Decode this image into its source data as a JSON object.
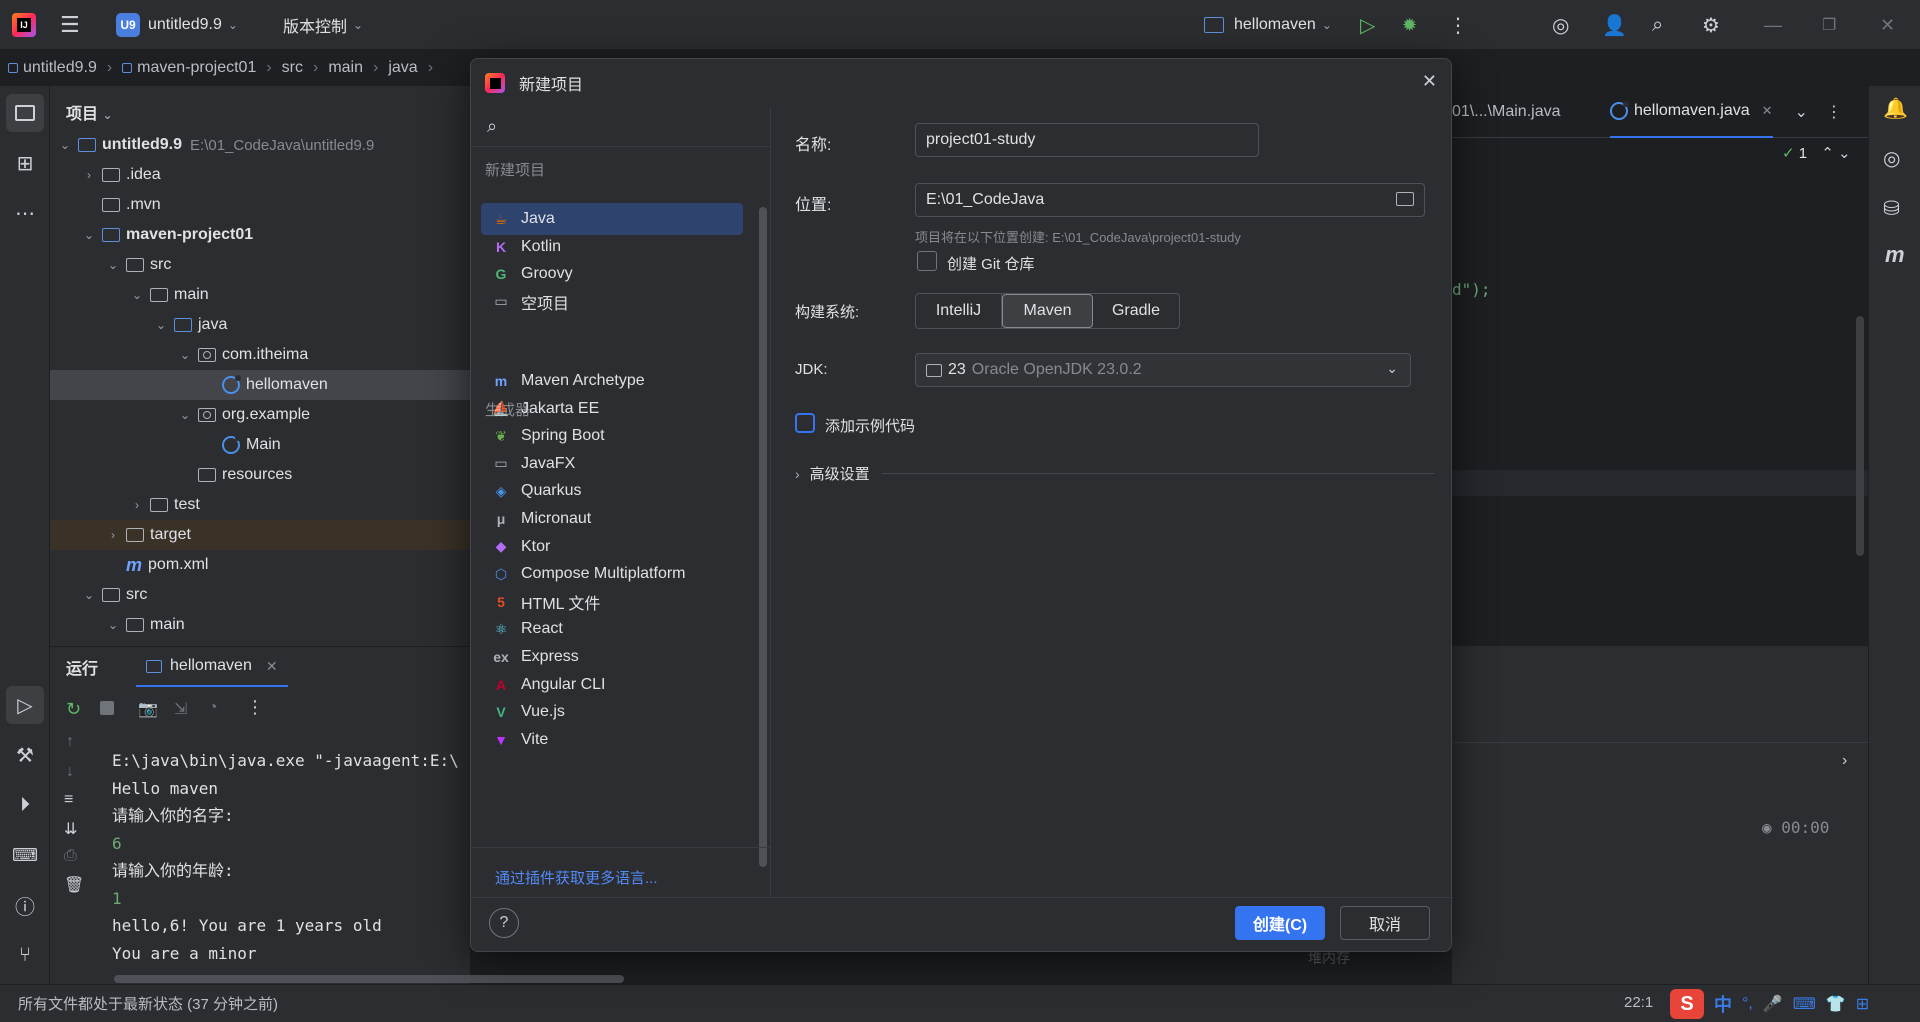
{
  "titlebar": {
    "project_badge": "U9",
    "project_name": "untitled9.9",
    "vcs_label": "版本控制",
    "run_config": "hellomaven"
  },
  "breadcrumb": [
    "untitled9.9",
    "maven-project01",
    "src",
    "main",
    "java"
  ],
  "project_panel": {
    "title": "项目",
    "tree": [
      {
        "label": "untitled9.9",
        "path": "E:\\01_CodeJava\\untitled9.9",
        "indent": 0,
        "arrow": "down",
        "icon": "module"
      },
      {
        "label": ".idea",
        "indent": 1,
        "arrow": "right",
        "icon": "folder"
      },
      {
        "label": ".mvn",
        "indent": 1,
        "arrow": "",
        "icon": "folder"
      },
      {
        "label": "maven-project01",
        "indent": 1,
        "arrow": "down",
        "icon": "module"
      },
      {
        "label": "src",
        "indent": 2,
        "arrow": "down",
        "icon": "folder"
      },
      {
        "label": "main",
        "indent": 3,
        "arrow": "down",
        "icon": "folder"
      },
      {
        "label": "java",
        "indent": 4,
        "arrow": "down",
        "icon": "folder-blue"
      },
      {
        "label": "com.itheima",
        "indent": 5,
        "arrow": "down",
        "icon": "package"
      },
      {
        "label": "hellomaven",
        "indent": 6,
        "arrow": "",
        "icon": "java-class"
      },
      {
        "label": "org.example",
        "indent": 5,
        "arrow": "down",
        "icon": "package"
      },
      {
        "label": "Main",
        "indent": 6,
        "arrow": "",
        "icon": "java-class"
      },
      {
        "label": "resources",
        "indent": 5,
        "arrow": "",
        "icon": "folder"
      },
      {
        "label": "test",
        "indent": 3,
        "arrow": "right",
        "icon": "folder"
      },
      {
        "label": "target",
        "indent": 2,
        "arrow": "right",
        "icon": "folder"
      },
      {
        "label": "pom.xml",
        "indent": 2,
        "arrow": "",
        "icon": "maven"
      },
      {
        "label": "src",
        "indent": 1,
        "arrow": "down",
        "icon": "folder"
      },
      {
        "label": "main",
        "indent": 2,
        "arrow": "down",
        "icon": "folder"
      }
    ]
  },
  "run_panel": {
    "title": "运行",
    "tab": "hellomaven",
    "console": [
      {
        "text": "E:\\java\\bin\\java.exe \"-javaagent:E:\\",
        "green": false
      },
      {
        "text": "Hello maven",
        "green": false
      },
      {
        "text": "请输入你的名字:",
        "green": false
      },
      {
        "text": "6",
        "green": true
      },
      {
        "text": "请输入你的年龄:",
        "green": false
      },
      {
        "text": "1",
        "green": true
      },
      {
        "text": "hello,6! You are 1 years old",
        "green": false
      },
      {
        "text": "You are a minor",
        "green": false
      }
    ]
  },
  "editor": {
    "tab1": "01\\...\\Main.java",
    "tab2": "hellomaven.java",
    "code_fragment": "d\");",
    "inspection_count": "1",
    "timer": "00:00",
    "memory_label": "堆内存"
  },
  "statusbar": {
    "message": "所有文件都处于最新状态 (37 分钟之前)",
    "position": "22:1",
    "ime": [
      "中",
      "°,"
    ]
  },
  "dialog": {
    "title": "新建项目",
    "group_new": "新建项目",
    "new_items": [
      {
        "label": "Java",
        "icon": "java-icon",
        "color": "#e76f00",
        "glyph": "☕"
      },
      {
        "label": "Kotlin",
        "icon": "kotlin-icon",
        "color": "#b36cf6",
        "glyph": "K"
      },
      {
        "label": "Groovy",
        "icon": "groovy-icon",
        "color": "#4fb877",
        "glyph": "G"
      },
      {
        "label": "空项目",
        "icon": "empty-project-icon",
        "color": "#aeb1b8",
        "glyph": "▭"
      }
    ],
    "group_gen": "生成器",
    "gen_items": [
      {
        "label": "Maven Archetype",
        "icon": "maven-icon",
        "color": "#6fa3ff",
        "glyph": "m"
      },
      {
        "label": "Jakarta EE",
        "icon": "jakarta-icon",
        "color": "#f0a030",
        "glyph": "⛵"
      },
      {
        "label": "Spring Boot",
        "icon": "spring-icon",
        "color": "#6ab04c",
        "glyph": "❦"
      },
      {
        "label": "JavaFX",
        "icon": "javafx-icon",
        "color": "#aeb1b8",
        "glyph": "▭"
      },
      {
        "label": "Quarkus",
        "icon": "quarkus-icon",
        "color": "#4695eb",
        "glyph": "◈"
      },
      {
        "label": "Micronaut",
        "icon": "micronaut-icon",
        "color": "#aeb1b8",
        "glyph": "μ"
      },
      {
        "label": "Ktor",
        "icon": "ktor-icon",
        "color": "#b36cf6",
        "glyph": "◆"
      },
      {
        "label": "Compose Multiplatform",
        "icon": "compose-icon",
        "color": "#4a8fe8",
        "glyph": "⬡"
      },
      {
        "label": "HTML 文件",
        "icon": "html-icon",
        "color": "#e44d26",
        "glyph": "5"
      },
      {
        "label": "React",
        "icon": "react-icon",
        "color": "#61dafb",
        "glyph": "⚛"
      },
      {
        "label": "Express",
        "icon": "express-icon",
        "color": "#aeb1b8",
        "glyph": "ex"
      },
      {
        "label": "Angular CLI",
        "icon": "angular-icon",
        "color": "#c3002f",
        "glyph": "A"
      },
      {
        "label": "Vue.js",
        "icon": "vue-icon",
        "color": "#41b883",
        "glyph": "V"
      },
      {
        "label": "Vite",
        "icon": "vite-icon",
        "color": "#bd34fe",
        "glyph": "▼"
      }
    ],
    "more_link": "通过插件获取更多语言...",
    "name_label": "名称:",
    "name_value": "project01-study",
    "location_label": "位置:",
    "location_value": "E:\\01_CodeJava",
    "location_hint": "项目将在以下位置创建: E:\\01_CodeJava\\project01-study",
    "git_label": "创建 Git 仓库",
    "build_label": "构建系统:",
    "build_options": [
      "IntelliJ",
      "Maven",
      "Gradle"
    ],
    "build_selected": "Maven",
    "jdk_label": "JDK:",
    "jdk_version": "23",
    "jdk_name": "Oracle OpenJDK 23.0.2",
    "sample_label": "添加示例代码",
    "advanced_label": "高级设置",
    "help": "?",
    "create": "创建(C)",
    "cancel": "取消"
  }
}
